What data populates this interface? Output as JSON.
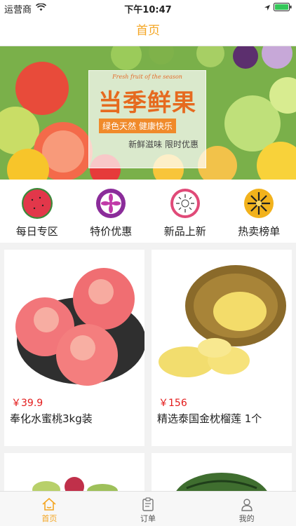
{
  "status": {
    "carrier": "运营商",
    "time": "下午10:47"
  },
  "nav": {
    "title": "首页"
  },
  "banner": {
    "english": "Fresh fruit of the season",
    "headline": "当季鲜果",
    "tag": "绿色天然  健康快乐",
    "subline": "新鲜滋味 限时优惠",
    "page_count": 2,
    "active_page": 0
  },
  "categories": [
    {
      "label": "每日专区",
      "icon": "watermelon-icon",
      "color": "#e2374a"
    },
    {
      "label": "特价优惠",
      "icon": "dragonfruit-icon",
      "color": "#8b2c9a"
    },
    {
      "label": "新品上新",
      "icon": "kiwi-icon",
      "color": "#e04a78"
    },
    {
      "label": "热卖榜单",
      "icon": "passionfruit-icon",
      "color": "#f2b21c"
    }
  ],
  "products": [
    {
      "price": "￥39.9",
      "name": "奉化水蜜桃3kg装",
      "image": "peach-image"
    },
    {
      "price": "￥156",
      "name": "精选泰国金枕榴莲 1个",
      "image": "durian-image"
    }
  ],
  "tabs": [
    {
      "label": "首页",
      "icon": "home-icon",
      "active": true
    },
    {
      "label": "订单",
      "icon": "order-icon",
      "active": false
    },
    {
      "label": "我的",
      "icon": "profile-icon",
      "active": false
    }
  ],
  "colors": {
    "accent": "#f4a623",
    "price": "#e31b1b"
  }
}
